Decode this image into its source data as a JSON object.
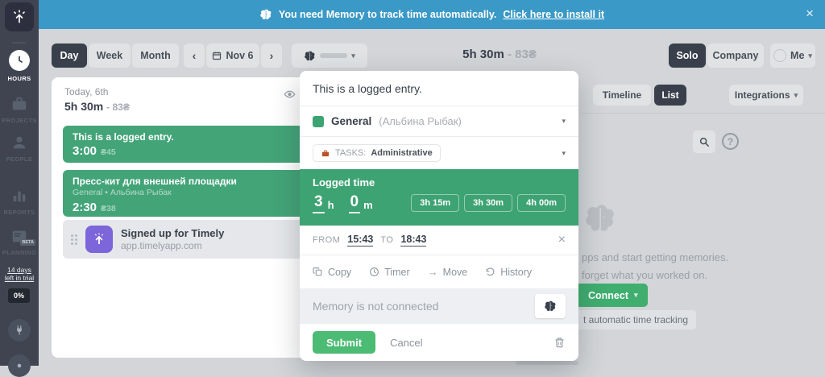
{
  "colors": {
    "accent_green": "#3ea373",
    "submit_green": "#4cbb74",
    "banner_blue": "#3a99c6",
    "dark_button": "#39404c",
    "sidebar_bg": "#3f4450",
    "app_purple": "#7c66d9"
  },
  "banner": {
    "text": "You need Memory to track time automatically.",
    "link": "Click here to install it"
  },
  "icons": {
    "close": "×",
    "caret": "▾",
    "prev": "‹",
    "next": "›",
    "help": "?",
    "move": "→",
    "bullet": "•"
  },
  "sidebar": {
    "items": [
      {
        "label": "HOURS"
      },
      {
        "label": "PROJECTS"
      },
      {
        "label": "PEOPLE"
      },
      {
        "label": "REPORTS"
      },
      {
        "label": "PLANNING"
      }
    ],
    "beta": "BETA",
    "trial_line1": "14 days",
    "trial_line2": "left in trial",
    "progress": "0%"
  },
  "toolbar": {
    "views": [
      {
        "label": "Day"
      },
      {
        "label": "Week"
      },
      {
        "label": "Month"
      }
    ],
    "date": "Nov 6",
    "total": "5h 30m",
    "total_amount": "- 83₴",
    "solo": "Solo",
    "company": "Company",
    "me": "Me"
  },
  "day": {
    "title": "Today, 6th",
    "total": "5h 30m",
    "amount": "- 83₴"
  },
  "entries": [
    {
      "title": "This is a logged entry.",
      "time": "3:00",
      "amount": "₴45"
    },
    {
      "title": "Пресс-кит для внешней площадки",
      "meta": "General • Альбина Рыбак",
      "time": "2:30",
      "amount": "₴38"
    },
    {
      "title": "Signed up for Timely",
      "meta": "app.timelyapp.com"
    }
  ],
  "right": {
    "timeline": "Timeline",
    "list": "List",
    "integrations": "Integrations",
    "line1": "pps and start getting memories.",
    "line2": "forget what you worked on.",
    "connect": "Connect",
    "badge": "t automatic time tracking"
  },
  "modal": {
    "note": "This is a logged entry.",
    "project": "General",
    "project_meta": "(Альбина Рыбак)",
    "tag_prefix": "TASKS:",
    "tag_value": "Administrative",
    "logged_label": "Logged time",
    "hours": "3",
    "hours_unit": "h",
    "minutes": "0",
    "minutes_unit": "m",
    "presets": [
      "3h 15m",
      "3h 30m",
      "4h 00m"
    ],
    "from_label": "FROM",
    "from": "15:43",
    "to_label": "TO",
    "to": "18:43",
    "actions": [
      {
        "label": "Copy"
      },
      {
        "label": "Timer"
      },
      {
        "label": "Move"
      },
      {
        "label": "History"
      }
    ],
    "memory_status": "Memory is not connected",
    "submit": "Submit",
    "cancel": "Cancel"
  }
}
